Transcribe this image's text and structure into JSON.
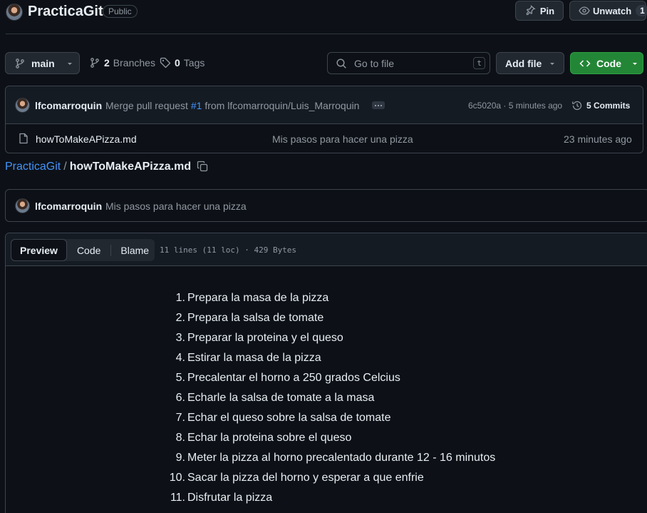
{
  "repo": {
    "name": "PracticaGit",
    "visibility": "Public"
  },
  "header_actions": {
    "pin_label": "Pin",
    "watch_label": "Unwatch",
    "watch_count": "1"
  },
  "toolbar": {
    "branch": "main",
    "branches_count": "2",
    "branches_label": "Branches",
    "tags_count": "0",
    "tags_label": "Tags",
    "search_placeholder": "Go to file",
    "search_shortcut": "t",
    "add_file_label": "Add file",
    "code_label": "Code"
  },
  "latest_commit": {
    "author": "lfcomarroquin",
    "message_prefix": "Merge pull request",
    "pr": "#1",
    "message_suffix": "from lfcomarroquin/Luis_Marroquin",
    "sha": "6c5020a",
    "time": "· 5 minutes ago",
    "commits_label": "5 Commits"
  },
  "files": [
    {
      "name": "howToMakeAPizza.md",
      "message": "Mis pasos para hacer una pizza",
      "time": "23 minutes ago"
    }
  ],
  "breadcrumb": {
    "repo": "PracticaGit",
    "separator": "/",
    "file": "howToMakeAPizza.md"
  },
  "file_commit": {
    "author": "lfcomarroquin",
    "message": "Mis pasos para hacer una pizza"
  },
  "file_view": {
    "tabs": [
      "Preview",
      "Code",
      "Blame"
    ],
    "active_tab": "Preview",
    "meta": "11 lines (11 loc) · 429 Bytes"
  },
  "content": {
    "steps": [
      "Prepara la masa de la pizza",
      "Prepara la salsa de tomate",
      "Preparar la proteina y el queso",
      "Estirar la masa de la pizza",
      "Precalentar el horno a 250 grados Celcius",
      "Echarle la salsa de tomate a la masa",
      "Echar el queso sobre la salsa de tomate",
      "Echar la proteina sobre el queso",
      "Meter la pizza al horno precalentado durante 12 - 16 minutos",
      "Sacar la pizza del horno y esperar a que enfrie",
      "Disfrutar la pizza"
    ]
  },
  "colors": {
    "background": "#0d1117",
    "accent_link": "#4493f8",
    "primary_button": "#238636",
    "border": "#3d444d"
  }
}
